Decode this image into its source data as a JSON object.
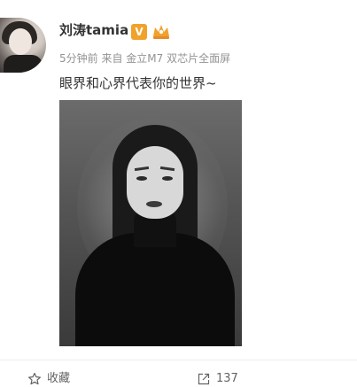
{
  "post": {
    "username": "刘涛tamia",
    "verified_badge": "V",
    "meta": "5分钟前 来自 金立M7 双芯片全面屏",
    "text": "眼界和心界代表你的世界~"
  },
  "actions": {
    "favorite_label": "收藏",
    "share_count": "137"
  },
  "icons": {
    "favorite": "star-outline-icon",
    "share": "share-arrow-icon",
    "vip": "crown-icon"
  },
  "colors": {
    "verified_badge": "#f0a22b",
    "meta_text": "#939393",
    "body_text": "#333333"
  }
}
